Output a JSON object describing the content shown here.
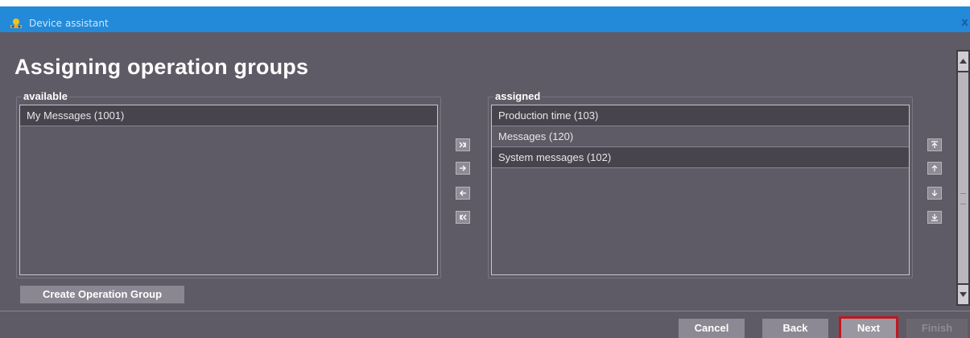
{
  "window": {
    "title": "Device assistant",
    "close_glyph": "x"
  },
  "page": {
    "heading": "Assigning operation groups"
  },
  "available": {
    "label": "available",
    "items": [
      "My Messages (1001)"
    ]
  },
  "assigned": {
    "label": "assigned",
    "items": [
      "Production time (103)",
      "Messages (120)",
      "System messages (102)"
    ]
  },
  "transfer_icons": [
    "move-all-right-icon",
    "move-right-icon",
    "move-left-icon",
    "move-all-left-icon"
  ],
  "order_icons": [
    "move-to-top-icon",
    "move-up-icon",
    "move-down-icon",
    "move-to-bottom-icon"
  ],
  "buttons": {
    "create_group": "Create Operation Group",
    "cancel": "Cancel",
    "back": "Back",
    "next": "Next",
    "finish": "Finish"
  },
  "colors": {
    "titlebar": "#238ad9",
    "background": "#5f5b66",
    "highlight": "#c4161c"
  }
}
